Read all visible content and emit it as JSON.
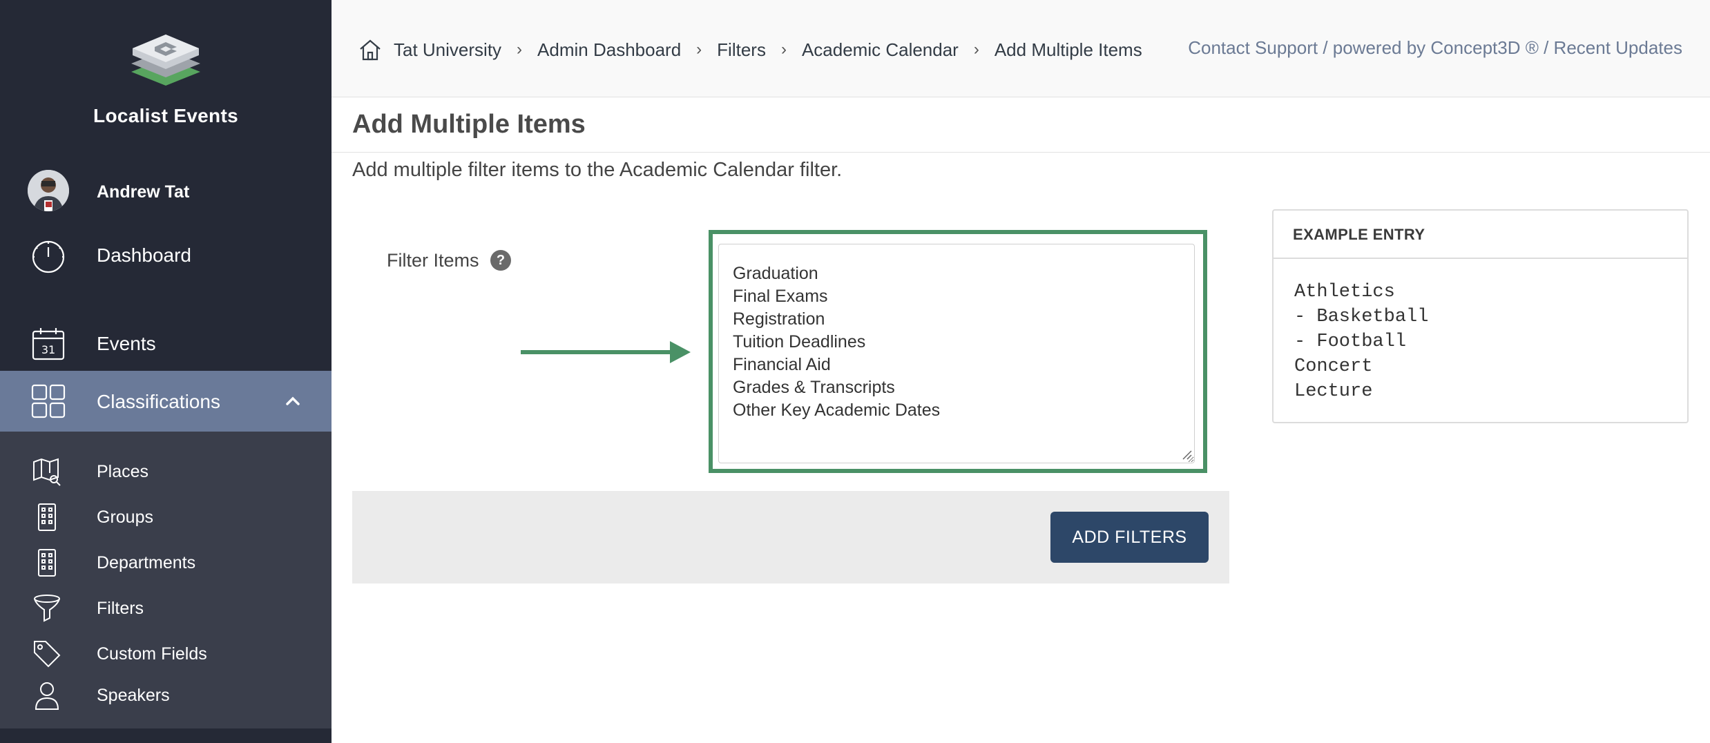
{
  "sidebar": {
    "brand": "Localist Events",
    "user": {
      "name": "Andrew Tat"
    },
    "nav": {
      "dashboard": "Dashboard",
      "events": "Events",
      "events_icon_day": "31",
      "classifications": "Classifications"
    },
    "sub_items": [
      {
        "label": "Places",
        "icon": "map-icon"
      },
      {
        "label": "Groups",
        "icon": "building-icon"
      },
      {
        "label": "Departments",
        "icon": "building-icon"
      },
      {
        "label": "Filters",
        "icon": "funnel-icon"
      },
      {
        "label": "Custom Fields",
        "icon": "tag-icon"
      },
      {
        "label": "Speakers",
        "icon": "person-icon"
      }
    ]
  },
  "breadcrumb": [
    "Tat University",
    "Admin Dashboard",
    "Filters",
    "Academic Calendar",
    "Add Multiple Items"
  ],
  "breadcrumb_separator": "›",
  "top_links": {
    "contact": "Contact Support",
    "powered": "powered by Concept3D ®",
    "updates": "Recent Updates",
    "separator": " / "
  },
  "page": {
    "title": "Add Multiple Items",
    "description": "Add multiple filter items to the Academic Calendar filter."
  },
  "form": {
    "label": "Filter Items",
    "help": "?",
    "items": [
      "Graduation",
      "Final Exams",
      "Registration",
      "Tuition Deadlines",
      "Financial Aid",
      "Grades & Transcripts",
      "Other Key Academic Dates"
    ],
    "submit_label": "ADD FILTERS"
  },
  "example": {
    "heading": "EXAMPLE ENTRY",
    "lines": [
      "Athletics",
      "- Basketball",
      "- Football",
      "Concert",
      "Lecture"
    ]
  },
  "colors": {
    "sidebar_bg": "#252936",
    "active_bg": "#6a7a99",
    "highlight_green": "#4a9166",
    "button_bg": "#2d4768"
  }
}
